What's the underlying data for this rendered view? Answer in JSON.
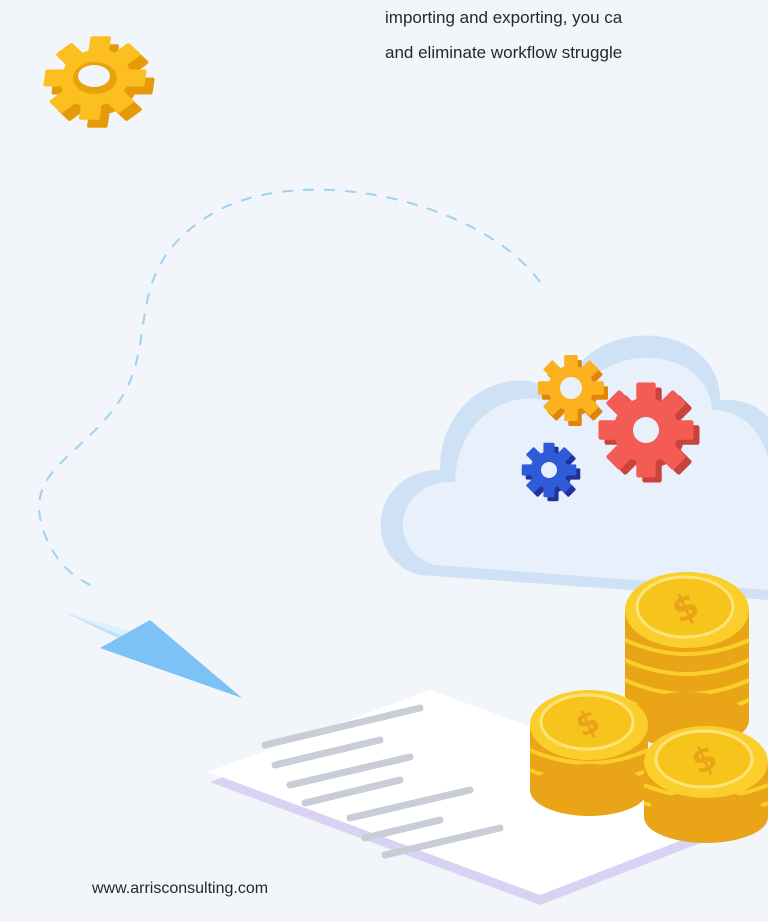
{
  "content": {
    "body_lines": [
      "importing and exporting, you ca",
      "and eliminate workflow struggle"
    ]
  },
  "footer": {
    "url": "www.arrisconsulting.com"
  },
  "colors": {
    "background": "#f2f6fa",
    "text": "#23282f",
    "gear_yellow": "#fbbf1f",
    "gear_red": "#f25c54",
    "gear_orange": "#fa9e12",
    "gear_blue": "#2f5bd8",
    "cloud": "#dbe8f6",
    "path_dash": "#9fd1f3",
    "paper_plane": "#7cc2f7",
    "coin_gold": "#f7c41c"
  },
  "icons": [
    "gear-icon",
    "cloud-icon",
    "paper-plane-icon",
    "document-icon",
    "coin-stack-icon",
    "dollar-icon"
  ]
}
